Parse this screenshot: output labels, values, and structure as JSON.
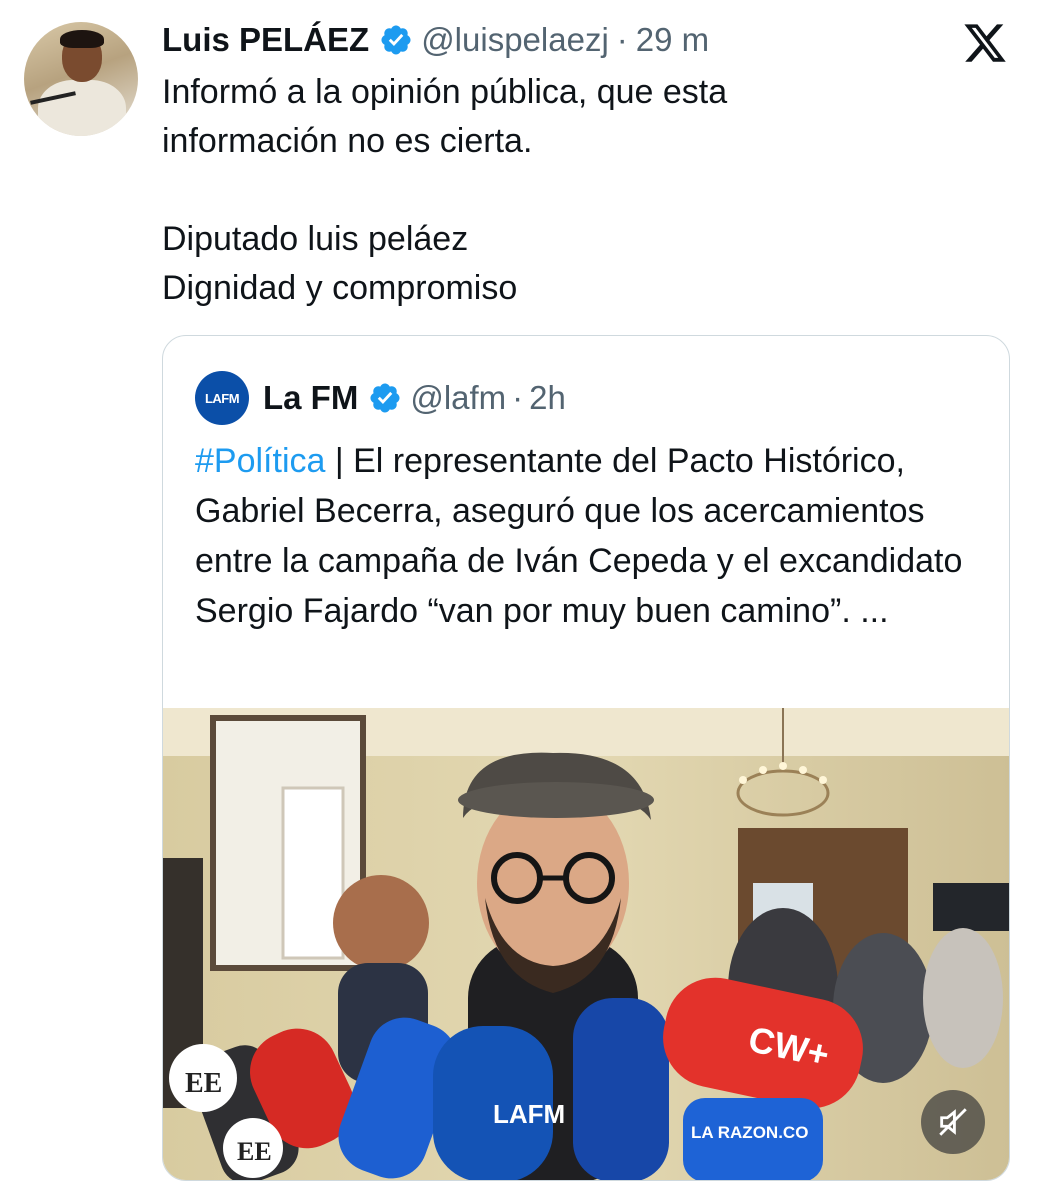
{
  "tweet": {
    "author_name": "Luis PELÁEZ",
    "handle": "@luispelaezj",
    "separator": "·",
    "time": "29 m",
    "lines": [
      "Informó a la opinión pública, que esta",
      "información no es cierta.",
      "",
      "Diputado luis peláez",
      "Dignidad y compromiso"
    ]
  },
  "quoted": {
    "logo_text": "LAFM",
    "author_name": "La FM",
    "handle": "@lafm",
    "separator": "·",
    "time": "2h",
    "hashtag": "#Política",
    "body_text": " | El representante del Pacto Histórico, Gabriel Becerra, aseguró que los acercamientos entre la campaña de Iván Cepeda y el excandidato Sergio Fajardo “van por muy buen camino”. ...",
    "media": {
      "mic_labels": [
        "LAFM",
        "CW+",
        "LA RAZON.CO",
        "EE",
        "EE"
      ]
    }
  },
  "icons": {
    "verified": "verified-badge-icon",
    "platform": "x-logo-icon",
    "mute": "speaker-muted-icon"
  },
  "colors": {
    "verified_blue": "#1d9bf0",
    "hashtag_blue": "#1d9bf0",
    "secondary_text": "#536471",
    "border": "#cfd9de"
  }
}
